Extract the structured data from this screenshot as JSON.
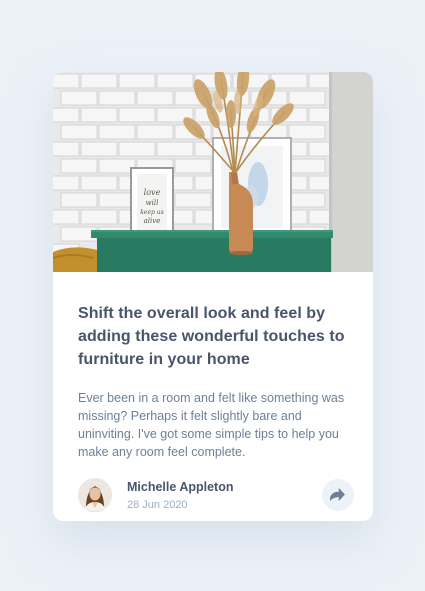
{
  "article": {
    "title": "Shift the overall look and feel by adding these wonderful touches to furniture in your home",
    "description": "Ever been in a room and felt like something was missing? Perhaps it felt slightly bare and uninviting. I've got some simple tips to help you make any room feel complete.",
    "image_icon": "drawers-photo"
  },
  "author": {
    "name": "Michelle Appleton",
    "date": "28 Jun 2020",
    "avatar_icon": "avatar-photo"
  },
  "actions": {
    "share_icon": "share-arrow-icon"
  },
  "colors": {
    "page_background": "#ecf1f8",
    "card_background": "#ffffff",
    "heading": "#48556a",
    "body_text": "#6e8098",
    "muted_text": "#9eafc2",
    "share_button_background": "#ecf2f8"
  }
}
